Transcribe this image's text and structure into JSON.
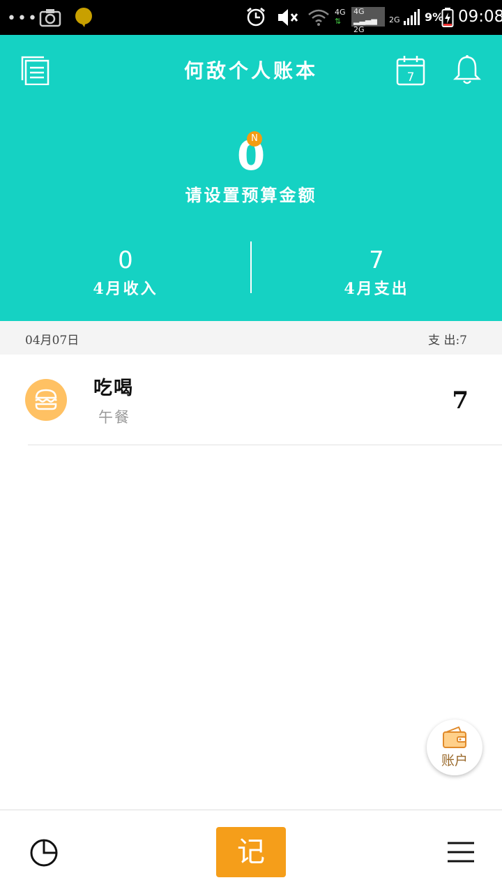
{
  "statusbar": {
    "dots": "•••",
    "net_4g": "4G",
    "sim_line1": "4G",
    "sim_line2": "2G",
    "net_2g": "2G",
    "battery_percent": "9%",
    "time": "09:08"
  },
  "header": {
    "title": "何敌个人账本",
    "calendar_day": "7",
    "budget_value": "0",
    "budget_badge": "N",
    "budget_label": "请设置预算金额",
    "income_value": "0",
    "income_label": "4月收入",
    "expense_value": "7",
    "expense_label": "4月支出"
  },
  "day_group": {
    "date": "04月07日",
    "total": "支 出:7"
  },
  "entries": [
    {
      "category": "吃喝",
      "note": "午餐",
      "amount": "7",
      "icon": "burger-icon"
    }
  ],
  "account_button": {
    "label": "账户",
    "icon": "wallet-icon"
  },
  "bottom_nav": {
    "chart_icon": "pie-chart-icon",
    "record_label": "记",
    "menu_icon": "menu-icon"
  },
  "colors": {
    "header_bg": "#15d2c3",
    "accent_orange": "#f59e1a",
    "category_icon_bg": "#ffc163"
  }
}
